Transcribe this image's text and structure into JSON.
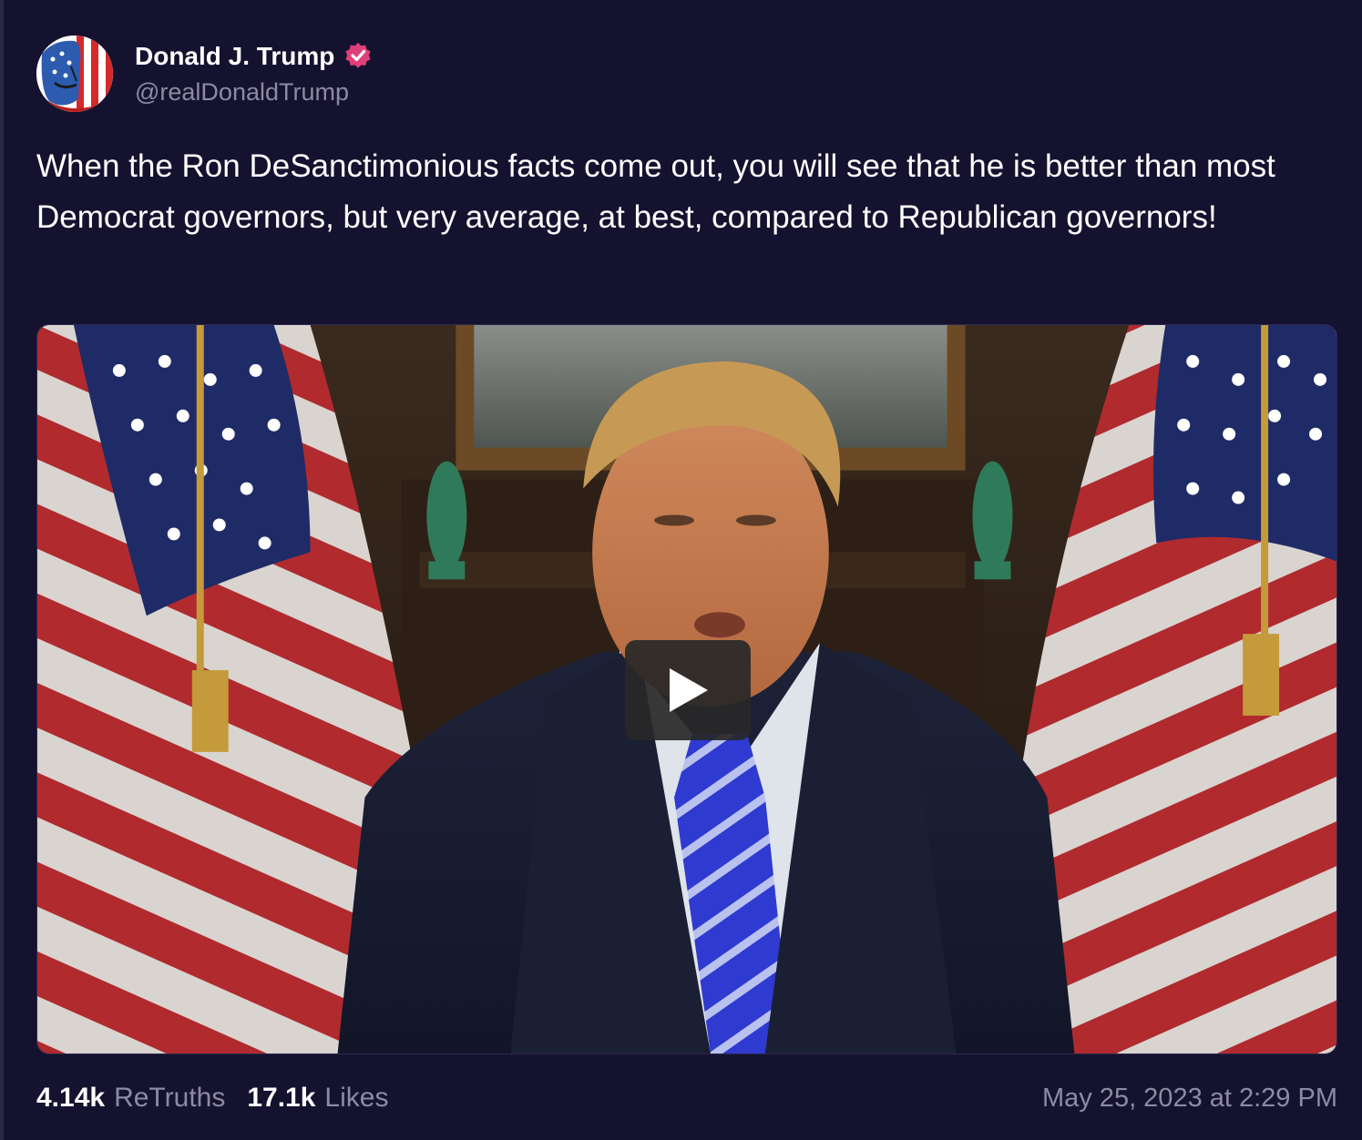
{
  "author": {
    "display_name": "Donald J. Trump",
    "handle": "@realDonaldTrump",
    "verified_color": "#e0407a"
  },
  "post": {
    "text": "When the Ron DeSanctimonious facts come out, you will see that he is better than most Democrat governors, but very average, at best, compared to Republican governors!"
  },
  "media": {
    "type": "video",
    "play_icon": "play-icon"
  },
  "stats": {
    "retruths_count": "4.14k",
    "retruths_label": "ReTruths",
    "likes_count": "17.1k",
    "likes_label": "Likes"
  },
  "timestamp": "May 25, 2023 at 2:29 PM",
  "colors": {
    "background": "#15122f",
    "text": "#ffffff",
    "muted": "#8d8aa3"
  }
}
